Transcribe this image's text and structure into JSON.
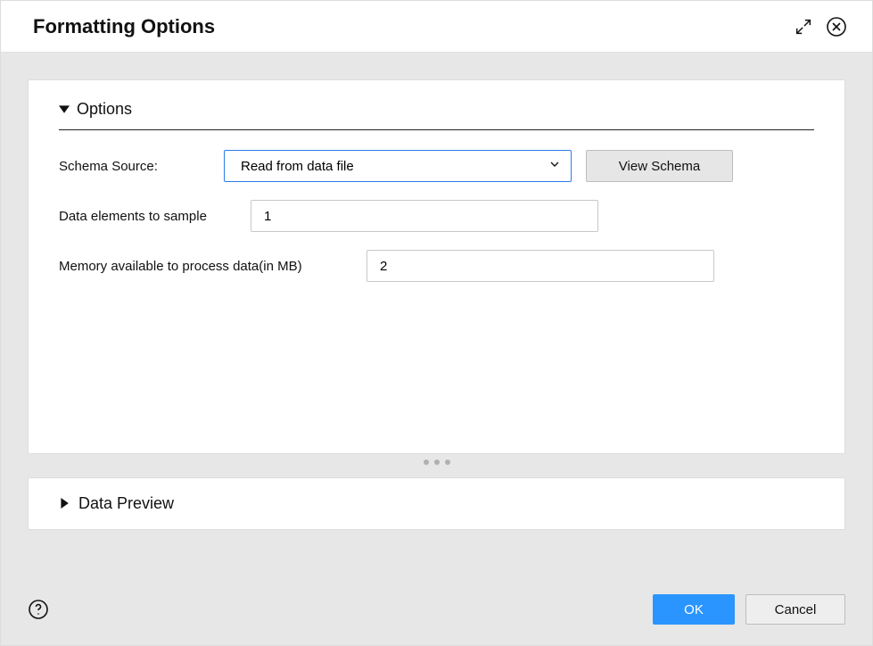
{
  "dialog": {
    "title": "Formatting Options"
  },
  "options": {
    "heading": "Options",
    "schema_label": "Schema Source:",
    "schema_value": "Read from data file",
    "view_schema_label": "View Schema",
    "sample_label": "Data elements to sample",
    "sample_value": "1",
    "memory_label": "Memory available to process data(in MB)",
    "memory_value": "2"
  },
  "preview": {
    "heading": "Data Preview"
  },
  "footer": {
    "ok_label": "OK",
    "cancel_label": "Cancel"
  }
}
